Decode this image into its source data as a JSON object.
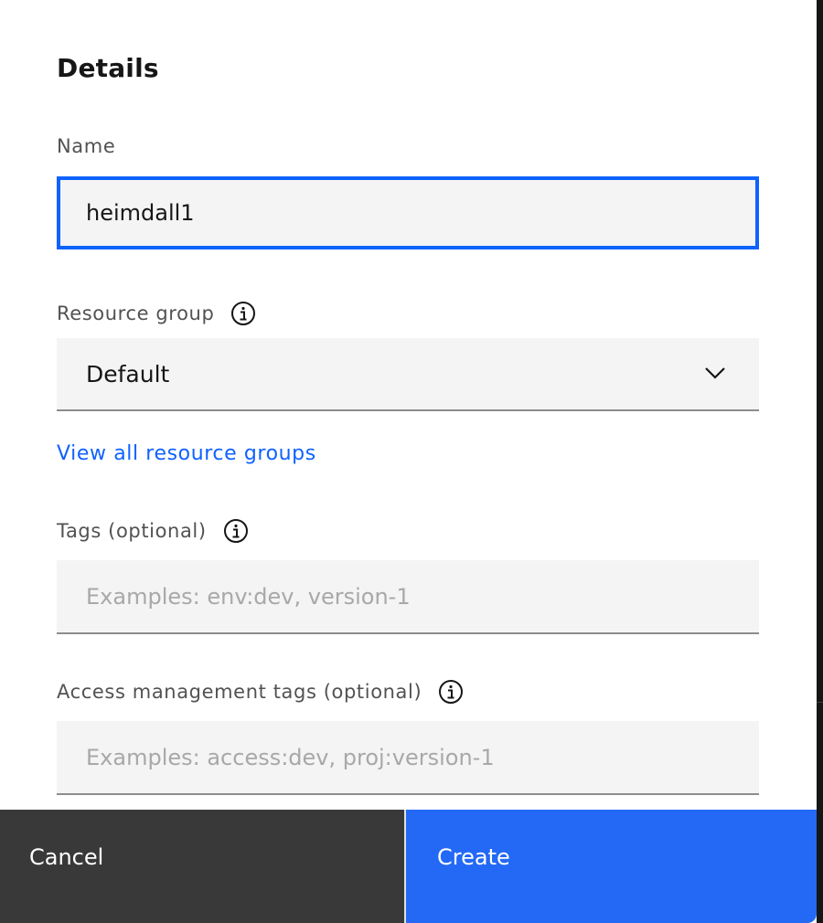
{
  "details": {
    "title": "Details"
  },
  "name_field": {
    "label": "Name",
    "value": "heimdall1"
  },
  "resource_group": {
    "label": "Resource group",
    "selected": "Default",
    "info_icon": "info-icon",
    "dropdown_icon": "chevron-down-icon"
  },
  "view_all_link": "View all resource groups",
  "tags_field": {
    "label": "Tags (optional)",
    "placeholder": "Examples: env:dev, version-1",
    "info_icon": "info-icon"
  },
  "access_tags_field": {
    "label": "Access management tags (optional)",
    "placeholder": "Examples: access:dev, proj:version-1",
    "info_icon": "info-icon"
  },
  "footer": {
    "cancel_label": "Cancel",
    "create_label": "Create"
  },
  "colors": {
    "primary": "#0f62fe",
    "create_button": "#2369f6",
    "cancel_button": "#393939",
    "field_background": "#f4f4f4",
    "label_text": "#525252"
  }
}
